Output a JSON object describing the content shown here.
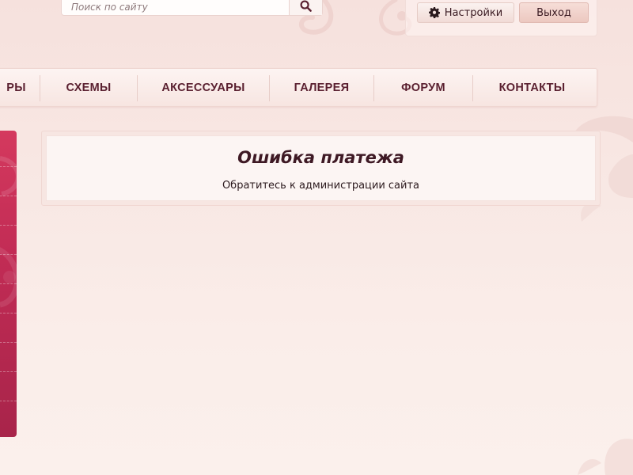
{
  "search": {
    "placeholder": "Поиск по сайту"
  },
  "user_panel": {
    "settings_label": "Настройки",
    "logout_label": "Выход"
  },
  "nav": {
    "items": [
      {
        "label": "РЫ"
      },
      {
        "label": "СХЕМЫ"
      },
      {
        "label": "АКСЕССУАРЫ"
      },
      {
        "label": "ГАЛЕРЕЯ"
      },
      {
        "label": "ФОРУМ"
      },
      {
        "label": "КОНТАКТЫ"
      }
    ]
  },
  "message": {
    "title": "Ошибка платежа",
    "text": "Обратитесь к администрации сайта"
  },
  "icons": {
    "search": "search-icon",
    "settings": "gear-icon"
  },
  "colors": {
    "accent": "#c22c55",
    "text": "#3a1a22",
    "nav_text": "#5a2030"
  }
}
